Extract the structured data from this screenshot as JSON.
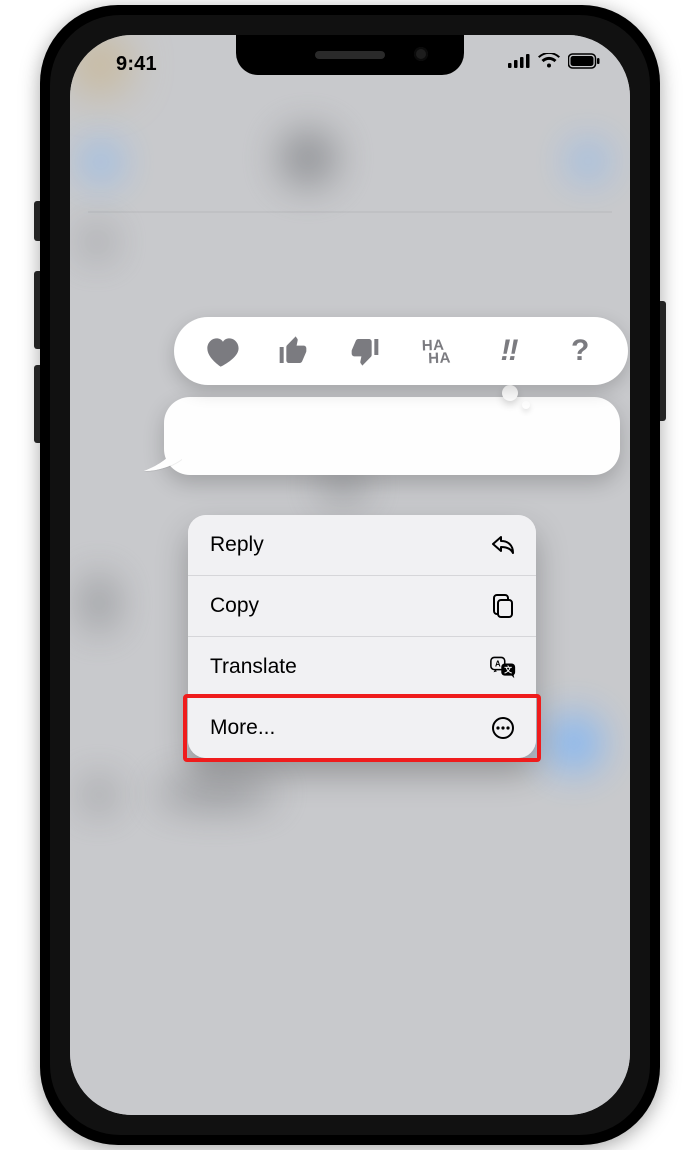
{
  "statusbar": {
    "time": "9:41"
  },
  "tapback": {
    "reactions": [
      {
        "name": "heart"
      },
      {
        "name": "thumbs-up"
      },
      {
        "name": "thumbs-down"
      },
      {
        "name": "haha",
        "label_top": "HA",
        "label_bottom": "HA"
      },
      {
        "name": "exclaim",
        "label": "!!"
      },
      {
        "name": "question",
        "label": "?"
      }
    ]
  },
  "context_menu": {
    "items": [
      {
        "label": "Reply",
        "icon": "reply"
      },
      {
        "label": "Copy",
        "icon": "copy"
      },
      {
        "label": "Translate",
        "icon": "translate"
      },
      {
        "label": "More...",
        "icon": "more",
        "highlighted": true
      }
    ]
  }
}
